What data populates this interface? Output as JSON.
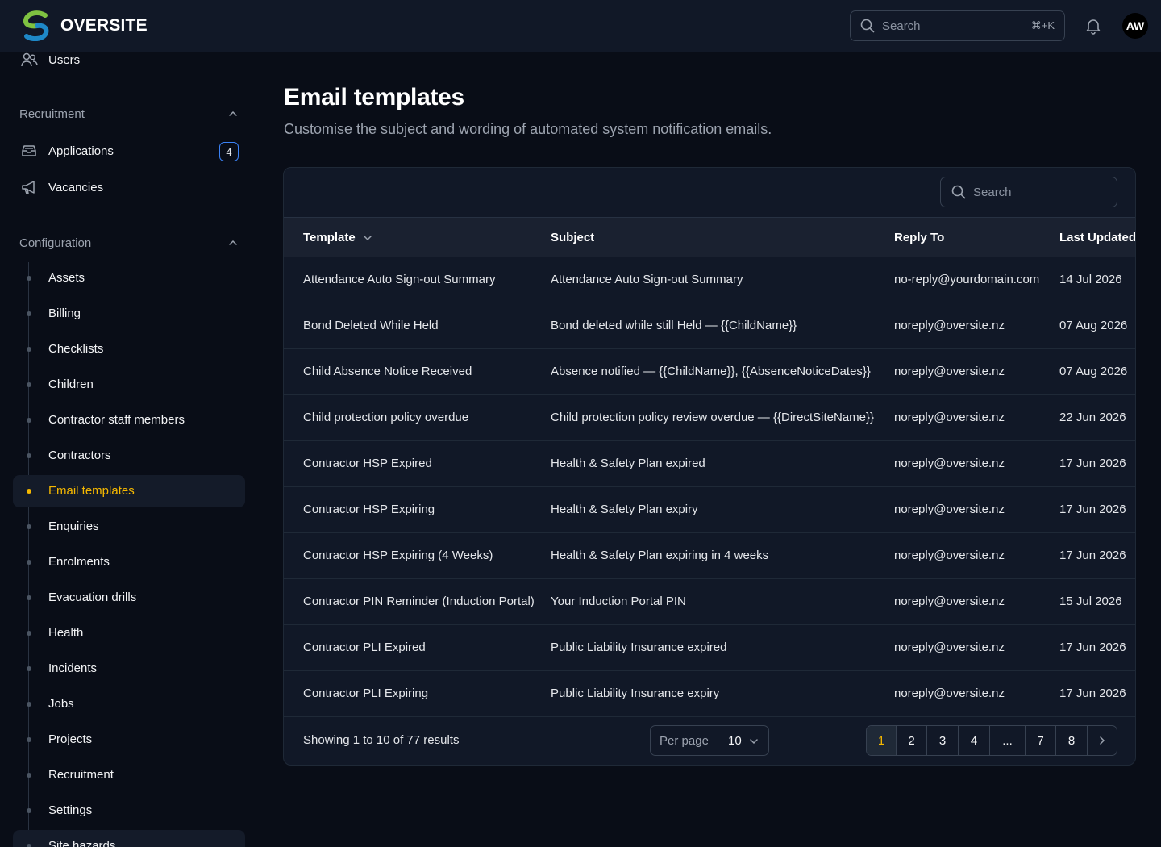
{
  "app": {
    "brand": "OVERSITE",
    "brand_colors": {
      "green": "#7fc241",
      "blue": "#1e88c7"
    }
  },
  "topbar": {
    "search_placeholder": "Search",
    "search_shortcut": "⌘+K",
    "avatar_initials": "AW"
  },
  "sidebar": {
    "users_label": "Users",
    "recruitment": {
      "heading": "Recruitment",
      "items": [
        {
          "label": "Applications",
          "badge": "4"
        },
        {
          "label": "Vacancies"
        }
      ]
    },
    "configuration": {
      "heading": "Configuration",
      "items": [
        "Assets",
        "Billing",
        "Checklists",
        "Children",
        "Contractor staff members",
        "Contractors",
        "Email templates",
        "Enquiries",
        "Enrolments",
        "Evacuation drills",
        "Health",
        "Incidents",
        "Jobs",
        "Projects",
        "Recruitment",
        "Settings",
        "Site hazards"
      ],
      "active": "Email templates"
    }
  },
  "main": {
    "title": "Email templates",
    "subtitle": "Customise the subject and wording of automated system notification emails.",
    "table_search_placeholder": "Search",
    "columns": [
      "Template",
      "Subject",
      "Reply To",
      "Last Updated"
    ],
    "rows": [
      [
        "Attendance Auto Sign-out Summary",
        "Attendance Auto Sign-out Summary",
        "no-reply@yourdomain.com",
        "14 Jul 2026"
      ],
      [
        "Bond Deleted While Held",
        "Bond deleted while still Held — {{ChildName}}",
        "noreply@oversite.nz",
        "07 Aug 2026"
      ],
      [
        "Child Absence Notice Received",
        "Absence notified — {{ChildName}}, {{AbsenceNoticeDates}}",
        "noreply@oversite.nz",
        "07 Aug 2026"
      ],
      [
        "Child protection policy overdue",
        "Child protection policy review overdue — {{DirectSiteName}}",
        "noreply@oversite.nz",
        "22 Jun 2026"
      ],
      [
        "Contractor HSP Expired",
        "Health & Safety Plan expired",
        "noreply@oversite.nz",
        "17 Jun 2026"
      ],
      [
        "Contractor HSP Expiring",
        "Health & Safety Plan expiry",
        "noreply@oversite.nz",
        "17 Jun 2026"
      ],
      [
        "Contractor HSP Expiring (4 Weeks)",
        "Health & Safety Plan expiring in 4 weeks",
        "noreply@oversite.nz",
        "17 Jun 2026"
      ],
      [
        "Contractor PIN Reminder (Induction Portal)",
        "Your Induction Portal PIN",
        "noreply@oversite.nz",
        "15 Jul 2026"
      ],
      [
        "Contractor PLI Expired",
        "Public Liability Insurance expired",
        "noreply@oversite.nz",
        "17 Jun 2026"
      ],
      [
        "Contractor PLI Expiring",
        "Public Liability Insurance expiry",
        "noreply@oversite.nz",
        "17 Jun 2026"
      ]
    ],
    "footer": {
      "showing": "Showing 1 to 10 of 77 results",
      "per_page_label": "Per page",
      "per_page_value": "10",
      "pages": [
        "1",
        "2",
        "3",
        "4",
        "...",
        "7",
        "8"
      ],
      "current_page": "1"
    }
  },
  "colors": {
    "accent": "#f5b800",
    "badge_border": "#3b82f6",
    "bg": "#090d17",
    "panel": "#111827"
  }
}
